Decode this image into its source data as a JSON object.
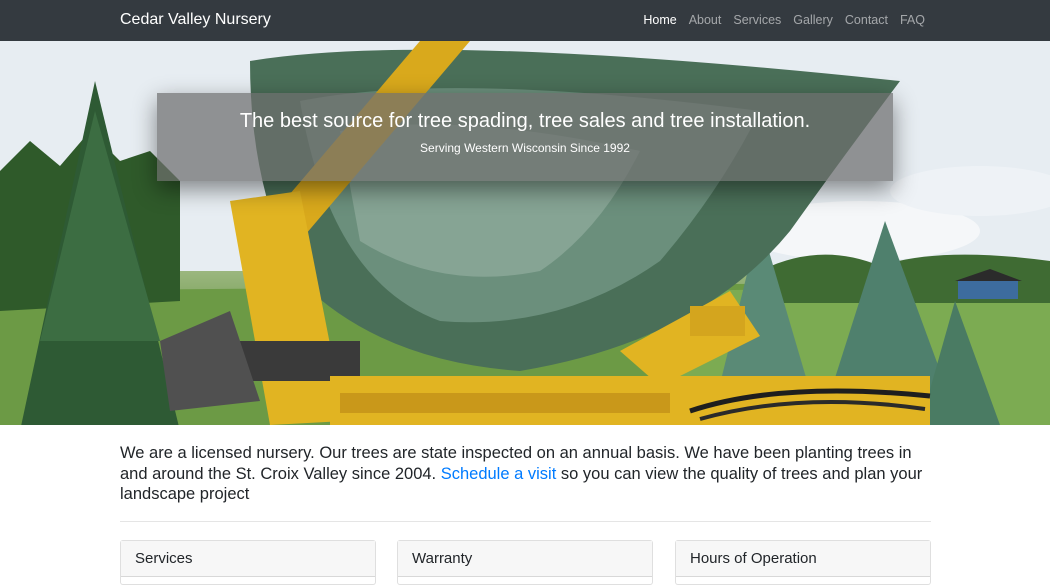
{
  "navbar": {
    "brand": "Cedar Valley Nursery",
    "links": [
      "Home",
      "About",
      "Services",
      "Gallery",
      "Contact",
      "FAQ"
    ],
    "active_index": 0
  },
  "hero": {
    "title": "The best source for tree spading, tree sales and tree installation.",
    "subtitle": "Serving Western Wisconsin Since 1992"
  },
  "intro": {
    "text_before": "We are a licensed nursery. Our trees are state inspected on an annual basis. We have been planting trees in and around the St. Croix Valley since 2004. ",
    "link": "Schedule a visit",
    "text_after": " so you can view the quality of trees and plan your landscape project"
  },
  "cards": [
    "Services",
    "Warranty",
    "Hours of Operation"
  ],
  "colors": {
    "navbar_bg": "#343a40",
    "link": "#007bff",
    "machine_yellow": "#e1b422"
  }
}
